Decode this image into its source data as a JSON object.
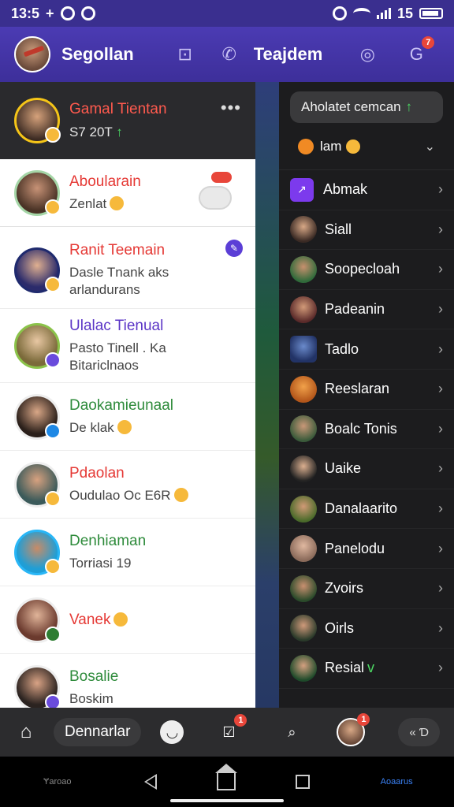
{
  "status_bar": {
    "time": "13:5",
    "indicator": "+",
    "battery_pct": "15"
  },
  "header": {
    "title": "Segollan",
    "title2": "Teajdem",
    "badge_count": "7"
  },
  "left_panel": {
    "profile": {
      "name": "Gamal Tientan",
      "sub": "S7 20T",
      "sub_arrow": "↑",
      "more": "•••"
    },
    "chats": [
      {
        "name": "Aboularain",
        "sub": "Zenlat",
        "name_color": "red",
        "selected": true
      },
      {
        "name": "Ranit Teemain",
        "sub": "Dasle Tnank aks arlandurans",
        "name_color": "red"
      },
      {
        "name": "Ulalac Tienual",
        "sub": "Pasto Tinell . Ka Bitariclnaos",
        "name_color": "purple"
      },
      {
        "name": "Daokamieunaal",
        "sub": "De klak",
        "name_color": "green"
      },
      {
        "name": "Pdaolan",
        "sub": "Oudulao Oc E6R",
        "name_color": "red"
      },
      {
        "name": "Denhiaman",
        "sub": "Torriasi 19",
        "name_color": "green"
      },
      {
        "name": "Vanek",
        "sub": "",
        "name_color": "red"
      },
      {
        "name": "Bosalie",
        "sub": "Boskim",
        "name_color": "green"
      }
    ]
  },
  "right_panel": {
    "search_text": "Aholatet cemcan",
    "search_arrow": "↑",
    "filter_label": "lam",
    "items": [
      {
        "label": "Abmak",
        "kind": "app"
      },
      {
        "label": "Siall"
      },
      {
        "label": "Soopecloah"
      },
      {
        "label": "Padeanin"
      },
      {
        "label": "Tadlo"
      },
      {
        "label": "Reeslaran"
      },
      {
        "label": "Boalc Tonis"
      },
      {
        "label": "Uaike"
      },
      {
        "label": "Danalaarito"
      },
      {
        "label": "Panelodu"
      },
      {
        "label": "Zvoirs"
      },
      {
        "label": "Oirls"
      },
      {
        "label": "Resial",
        "suffix": "v"
      }
    ]
  },
  "bottom_bar": {
    "pill_label": "Dennarlar",
    "task_badge": "1",
    "avatar_badge": "1",
    "right_pill": "« Ɗ"
  },
  "nav_bar": {
    "left_label": "Ɏaroao",
    "right_label": "Aoaarus"
  },
  "colors": {
    "header_purple": "#4b3bb3",
    "name_red": "#e53935",
    "name_purple": "#5b35c6",
    "name_green": "#2e8b3b",
    "accent_badge": "#e8463a"
  }
}
